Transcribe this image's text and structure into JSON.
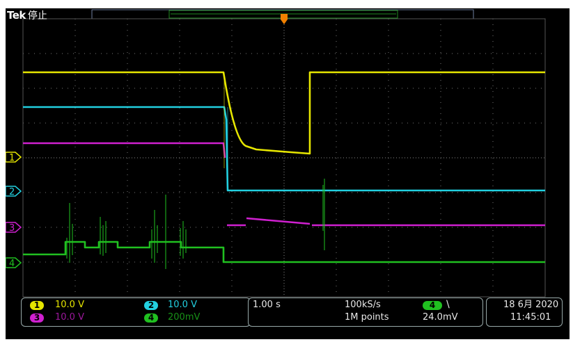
{
  "brand": {
    "logo": "Tek",
    "state": "停止"
  },
  "colors": {
    "ch1": "#e6e600",
    "ch2": "#22d0e0",
    "ch3": "#d020d0",
    "ch4": "#20c020",
    "grid": "#777777",
    "record_bar": "#1f8a1f",
    "trigger": "#f08000"
  },
  "markers": [
    {
      "id": "1",
      "color": "ch1",
      "name": "ch1-level-marker"
    },
    {
      "id": "2",
      "color": "ch2",
      "name": "ch2-level-marker"
    },
    {
      "id": "3",
      "color": "ch3",
      "name": "ch3-level-marker"
    },
    {
      "id": "4",
      "color": "ch4",
      "name": "ch4-level-marker"
    }
  ],
  "channels": [
    {
      "num": "1",
      "scale": "10.0 V",
      "color": "ch1",
      "active": true
    },
    {
      "num": "2",
      "scale": "10.0 V",
      "color": "ch2",
      "active": true
    },
    {
      "num": "3",
      "scale": "10.0 V",
      "color": "ch3",
      "active": false
    },
    {
      "num": "4",
      "scale": "200mV",
      "color": "ch4",
      "active": false
    }
  ],
  "timebase": {
    "scale": "1.00 s",
    "sample_rate": "100kS/s",
    "record_length": "1M points"
  },
  "trigger": {
    "source": "4",
    "slope": "falling",
    "slope_icon": "\\",
    "level": "24.0mV"
  },
  "datetime": {
    "date": "18 6月 2020",
    "time": "11:45:01"
  }
}
